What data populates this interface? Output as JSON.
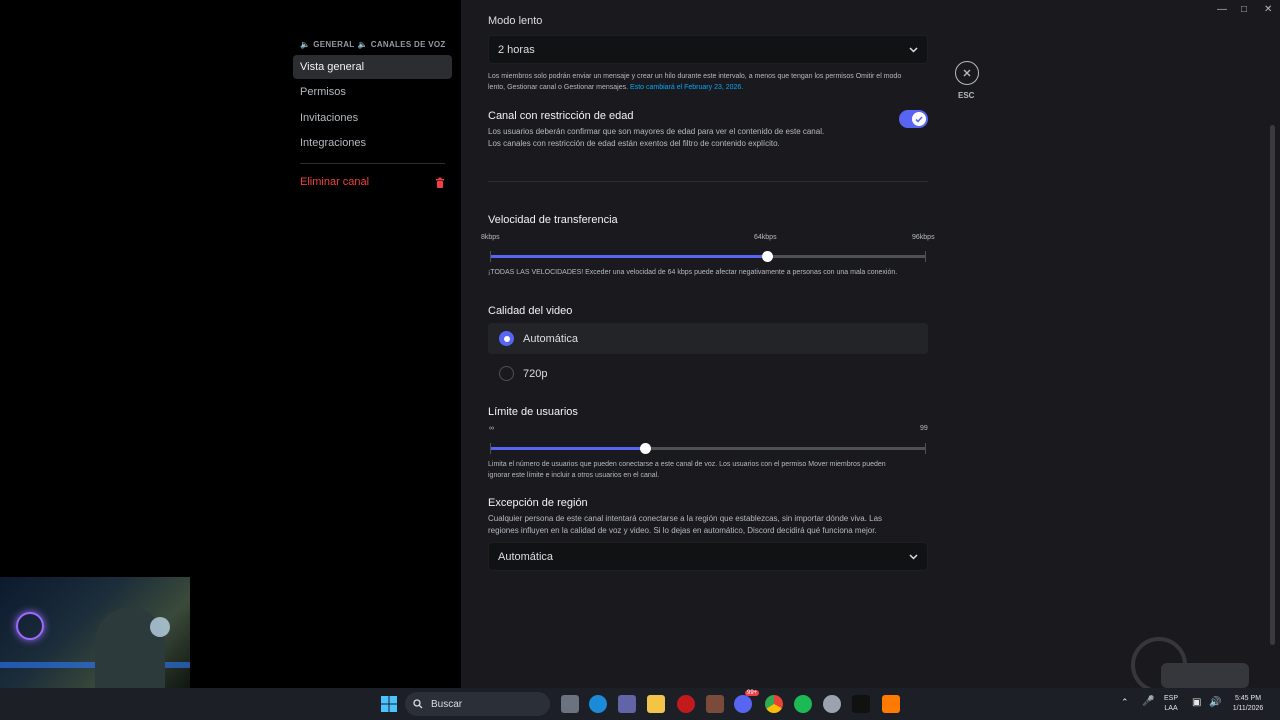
{
  "sidebar": {
    "header_category": "GENERAL",
    "header_channel": "CANALES DE VOZ",
    "items": [
      {
        "label": "Vista general",
        "active": true
      },
      {
        "label": "Permisos"
      },
      {
        "label": "Invitaciones"
      },
      {
        "label": "Integraciones"
      }
    ],
    "delete_label": "Eliminar canal"
  },
  "slow_mode": {
    "label": "Modo lento",
    "value": "2 horas",
    "help": "Los miembros solo podrán enviar un mensaje y crear un hilo durante este intervalo, a menos que tengan los permisos Omitir el modo lento, Gestionar canal o Gestionar mensajes.",
    "help_link": "Esto cambiará el February 23, 2026."
  },
  "age_restricted": {
    "title": "Canal con restricción de edad",
    "desc1": "Los usuarios deberán confirmar que son mayores de edad para ver el contenido de este canal.",
    "desc2": "Los canales con restricción de edad están exentos del filtro de contenido explícito.",
    "enabled": true
  },
  "bitrate": {
    "title": "Velocidad de transferencia",
    "min_label": "8kbps",
    "mid_label": "64kbps",
    "max_label": "96kbps",
    "value_kbps": 64,
    "min_kbps": 8,
    "max_kbps": 96,
    "help": "¡TODAS LAS VELOCIDADES! Exceder una velocidad de 64 kbps puede afectar negativamente a personas con una mala conexión."
  },
  "video_quality": {
    "title": "Calidad del video",
    "options": [
      {
        "label": "Automática",
        "selected": true
      },
      {
        "label": "720p",
        "selected": false
      }
    ]
  },
  "user_limit": {
    "title": "Límite de usuarios",
    "min_label": "∞",
    "max_label": "99",
    "fraction": 0.355,
    "help": "Limita el número de usuarios que pueden conectarse a este canal de voz. Los usuarios con el permiso Mover miembros pueden ignorar este límite e incluir a otros usuarios en el canal."
  },
  "region": {
    "title": "Excepción de región",
    "desc": "Cualquier persona de este canal intentará conectarse a la región que establezcas, sin importar dónde viva. Las regiones influyen en la calidad de voz y video. Si lo dejas en automático, Discord decidirá qué funciona mejor.",
    "value": "Automática"
  },
  "close": {
    "esc_label": "ESC"
  },
  "taskbar": {
    "search_placeholder": "Buscar",
    "lang_top": "ESP",
    "lang_bottom": "LAA",
    "time": "5:45 PM",
    "date": "1/11/2026",
    "discord_badge": "99+"
  },
  "colors": {
    "accent": "#5865f2",
    "danger": "#f23f43",
    "link": "#00a8fc"
  }
}
